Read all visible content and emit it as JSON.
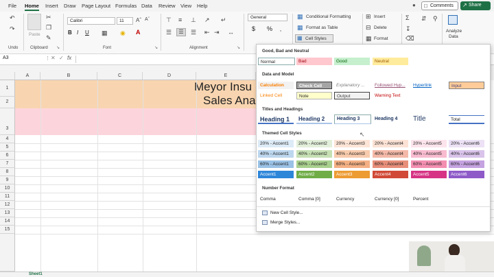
{
  "menu": {
    "tabs": [
      "File",
      "Home",
      "Insert",
      "Draw",
      "Page Layout",
      "Formulas",
      "Data",
      "Review",
      "View",
      "Help"
    ],
    "active_tab": "Home",
    "comments_label": "Comments",
    "share_label": "Share"
  },
  "ribbon": {
    "groups": {
      "undo": "Undo",
      "clipboard": "Clipboard",
      "font": "Font",
      "alignment": "Alignment"
    },
    "paste_label": "Paste",
    "font_name": "Calibri",
    "font_size": "11",
    "number_format": "General",
    "conditional_formatting": "Conditional Formatting",
    "format_as_table": "Format as Table",
    "cell_styles": "Cell Styles",
    "insert": "Insert",
    "delete": "Delete",
    "format": "Format",
    "analyze_data": [
      "Analyze",
      "Data"
    ],
    "bold": "B",
    "italic": "I",
    "underline": "U",
    "currency": "$",
    "percent": "%"
  },
  "formula_bar": {
    "name_box": "A3",
    "fx": "fx"
  },
  "grid": {
    "columns": [
      "A",
      "B",
      "C",
      "D",
      "E"
    ],
    "rows": [
      "1",
      "2",
      "3",
      "4",
      "5",
      "6",
      "7",
      "8",
      "9",
      "10",
      "11",
      "12",
      "13",
      "14",
      "15"
    ],
    "title_line1": "Meyor Insu",
    "title_line2": "Sales Ana",
    "sheet_tab": "Sheet1",
    "header_fill": "#f8d5b0",
    "row3_fill": "#fcd5dc"
  },
  "cell_styles_menu": {
    "sections": {
      "good_bad_neutral": "Good, Bad and Neutral",
      "data_model": "Data and Model",
      "titles_headings": "Titles and Headings",
      "themed": "Themed Cell Styles",
      "number_format": "Number Format"
    },
    "good_bad_neutral": [
      "Normal",
      "Bad",
      "Good",
      "Neutral"
    ],
    "data_model_row1": [
      "Calculation",
      "Check Cell",
      "Explanatory ...",
      "Followed Hyp...",
      "Hyperlink",
      "Input"
    ],
    "data_model_row2": [
      "Linked Cell",
      "Note",
      "Output",
      "Warning Text"
    ],
    "titles": [
      "Heading 1",
      "Heading 2",
      "Heading 3",
      "Heading 4",
      "Title",
      "Total"
    ],
    "themed_20": [
      "20% - Accent1",
      "20% - Accent2",
      "20% - Accent3",
      "20% - Accent4",
      "20% - Accent5",
      "20% - Accent6"
    ],
    "themed_40": [
      "40% - Accent1",
      "40% - Accent2",
      "40% - Accent3",
      "40% - Accent4",
      "40% - Accent5",
      "40% - Accent6"
    ],
    "themed_60": [
      "60% - Accent1",
      "60% - Accent2",
      "60% - Accent3",
      "60% - Accent4",
      "60% - Accent5",
      "60% - Accent6"
    ],
    "themed_accent": [
      "Accent1",
      "Accent2",
      "Accent3",
      "Accent4",
      "Accent5",
      "Accent6"
    ],
    "number_formats": [
      "Comma",
      "Comma [0]",
      "Currency",
      "Currency [0]",
      "Percent"
    ],
    "new_cell_style": "New Cell Style...",
    "merge_styles": "Merge Styles..."
  },
  "colors": {
    "excel_green": "#1e7145",
    "accent20": [
      "#ddebf7",
      "#fce4d6",
      "#ededed",
      "#fff2cc",
      "#fce4ec",
      "#ece1f5"
    ],
    "accent40": [
      "#bdd7ee",
      "#f8cbad",
      "#dbdbdb",
      "#ffe699",
      "#f8bbd0",
      "#d9c3ea"
    ],
    "accent60": [
      "#9bc2e6",
      "#a9d08e",
      "#c9c9c9",
      "#f4b084",
      "#f48fb1",
      "#c5a3e0"
    ],
    "accent": [
      "#2e86d9",
      "#70ad47",
      "#ed9b33",
      "#d04a37",
      "#d63384",
      "#8e5ac8"
    ]
  }
}
